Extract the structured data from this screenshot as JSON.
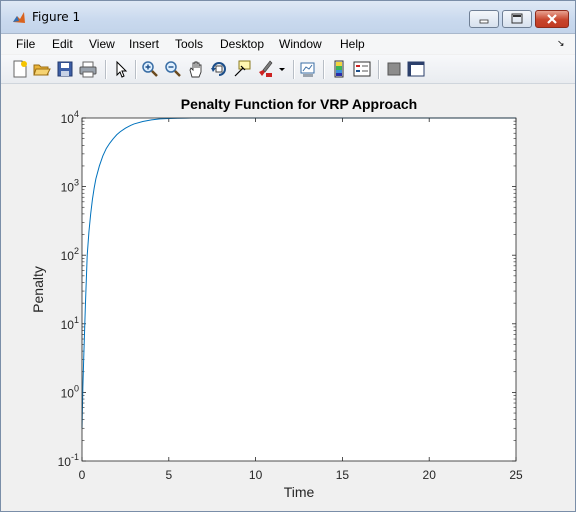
{
  "window": {
    "title": "Figure 1",
    "app_icon": "matlab-icon",
    "controls": [
      "minimize-icon",
      "maximize-icon",
      "close-icon"
    ]
  },
  "menu": {
    "items": [
      "File",
      "Edit",
      "View",
      "Insert",
      "Tools",
      "Desktop",
      "Window",
      "Help"
    ],
    "dock_glyph": "↘"
  },
  "toolbar": {
    "icons": [
      "new-figure-icon",
      "open-file-icon",
      "save-icon",
      "print-icon",
      "edit-plot-arrow-icon",
      "zoom-in-icon",
      "zoom-out-icon",
      "pan-hand-icon",
      "rotate-3d-icon",
      "data-cursor-icon",
      "brush-icon",
      "brush-dropdown-icon",
      "link-plot-icon",
      "insert-colorbar-icon",
      "insert-legend-icon",
      "hide-plot-tools-icon",
      "show-plot-tools-icon"
    ]
  },
  "chart_data": {
    "type": "line",
    "title": "Penalty Function for VRP Approach",
    "xlabel": "Time",
    "ylabel": "Penalty",
    "xlim": [
      0,
      25
    ],
    "ylim": [
      0.1,
      10000
    ],
    "yscale": "log",
    "xticks": [
      0,
      5,
      10,
      15,
      20,
      25
    ],
    "xtick_labels": [
      "0",
      "5",
      "10",
      "15",
      "20",
      "25"
    ],
    "yticks": [
      0.1,
      1,
      10,
      100,
      1000,
      10000
    ],
    "ytick_base": "10",
    "ytick_exponents": [
      "-1",
      "0",
      "1",
      "2",
      "3",
      "4"
    ],
    "grid": false,
    "line_color": "#0072bd",
    "series": [
      {
        "x": [
          0,
          0.05,
          0.1,
          0.15,
          0.2,
          0.3,
          0.4,
          0.5,
          0.6,
          0.7,
          0.8,
          1.0,
          1.2,
          1.4,
          1.6,
          1.8,
          2.0,
          2.2,
          2.5,
          2.8,
          3.0,
          3.5,
          4.0,
          4.5,
          5.0,
          5.5,
          6.0,
          6.3,
          25
        ],
        "y": [
          0.3,
          1.2,
          3.2,
          8,
          20,
          100,
          220,
          400,
          650,
          950,
          1300,
          2000,
          2800,
          3600,
          4300,
          5000,
          5700,
          6300,
          7100,
          7800,
          8200,
          8900,
          9400,
          9700,
          9850,
          9920,
          9970,
          10000,
          10000
        ]
      }
    ]
  }
}
